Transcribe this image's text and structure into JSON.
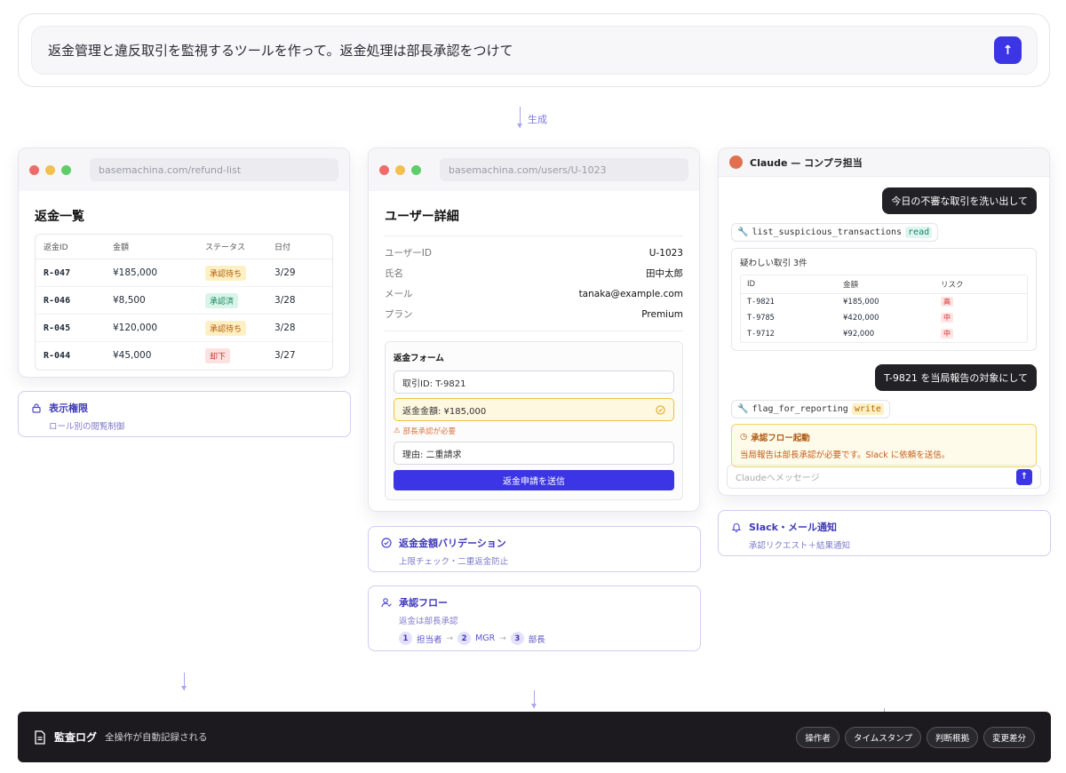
{
  "prompt": {
    "text": "返金管理と違反取引を監視するツールを作って。返金処理は部長承認をつけて",
    "send_icon": "arrow-up-icon"
  },
  "flow": {
    "generate_label": "生成"
  },
  "refund_window": {
    "url": "basemachina.com/refund-list",
    "title": "返金一覧",
    "columns": [
      "返金ID",
      "金額",
      "ステータス",
      "日付"
    ],
    "rows": [
      {
        "id": "R-047",
        "amount": "¥185,000",
        "status": "承認待ち",
        "status_kind": "wait",
        "date": "3/29"
      },
      {
        "id": "R-046",
        "amount": "¥8,500",
        "status": "承認済",
        "status_kind": "done",
        "date": "3/28"
      },
      {
        "id": "R-045",
        "amount": "¥120,000",
        "status": "承認待ち",
        "status_kind": "wait",
        "date": "3/28"
      },
      {
        "id": "R-044",
        "amount": "¥45,000",
        "status": "却下",
        "status_kind": "rej",
        "date": "3/27"
      }
    ]
  },
  "perm_feature": {
    "title": "表示権限",
    "subtitle": "ロール別の閲覧制御"
  },
  "user_window": {
    "url": "basemachina.com/users/U-1023",
    "title": "ユーザー詳細",
    "fields": [
      {
        "label": "ユーザーID",
        "value": "U-1023"
      },
      {
        "label": "氏名",
        "value": "田中太郎"
      },
      {
        "label": "メール",
        "value": "tanaka@example.com"
      },
      {
        "label": "プラン",
        "value": "Premium"
      }
    ],
    "form": {
      "title": "返金フォーム",
      "txn_field": "取引ID: T-9821",
      "amount_field": "返金金額: ¥185,000",
      "warning": "部長承認が必要",
      "reason_field": "理由: 二重請求",
      "submit": "返金申請を送信"
    }
  },
  "validation_feature": {
    "title": "返金金額バリデーション",
    "subtitle": "上限チェック・二重返金防止"
  },
  "approval_feature": {
    "title": "承認フロー",
    "subtitle": "返金は部長承認",
    "steps": [
      {
        "num": "1",
        "label": "担当者"
      },
      {
        "num": "2",
        "label": "MGR"
      },
      {
        "num": "3",
        "label": "部長"
      }
    ]
  },
  "chat": {
    "header": "Claude — コンプラ担当",
    "msg1": "今日の不審な取引を洗い出して",
    "tool1": {
      "name": "list_suspicious_transactions",
      "tag": "read"
    },
    "result_title": "疑わしい取引 3件",
    "result_columns": [
      "ID",
      "金額",
      "リスク"
    ],
    "result_rows": [
      {
        "id": "T-9821",
        "amount": "¥185,000",
        "risk": "高"
      },
      {
        "id": "T-9785",
        "amount": "¥420,000",
        "risk": "中"
      },
      {
        "id": "T-9712",
        "amount": "¥92,000",
        "risk": "中"
      }
    ],
    "msg2": "T-9821 を当局報告の対象にして",
    "tool2": {
      "name": "flag_for_reporting",
      "tag": "write"
    },
    "alert_title": "承認フロー起動",
    "alert_text": "当局報告は部長承認が必要です。Slack に依頼を送信。",
    "input_placeholder": "Claudeへメッセージ"
  },
  "notify_feature": {
    "title": "Slack・メール通知",
    "subtitle": "承認リクエスト＋結果通知"
  },
  "audit": {
    "title": "監査ログ",
    "subtitle": "全操作が自動記録される",
    "chips": [
      "操作者",
      "タイムスタンプ",
      "判断根拠",
      "変更差分"
    ]
  },
  "colors": {
    "accent": "#3b35e6",
    "feature_border": "#cfcdf3",
    "dark_bar": "#1c1a1f"
  }
}
